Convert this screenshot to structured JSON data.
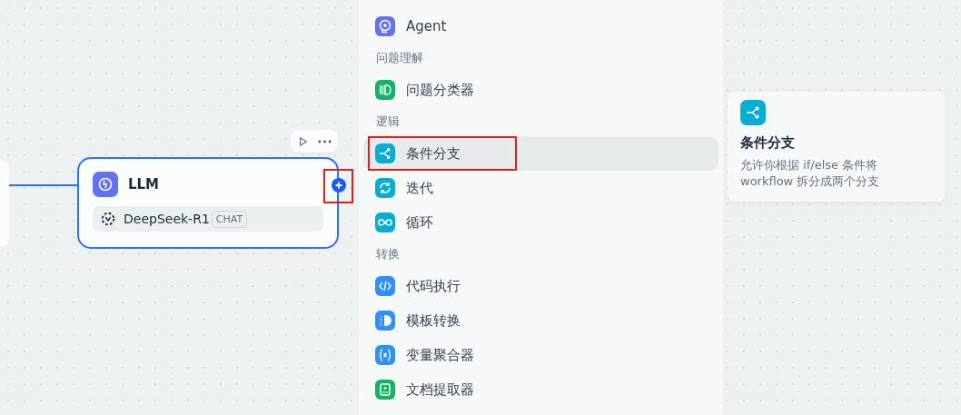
{
  "canvas": {
    "llm_node": {
      "title": "LLM",
      "selected": true,
      "model": "DeepSeek-R1",
      "badge": "CHAT",
      "add_button": {
        "highlighted": true
      }
    }
  },
  "block_menu": {
    "items": [
      {
        "kind": "item",
        "label": "Agent",
        "color": "#6172f3",
        "selected": false,
        "highlighted": false
      },
      {
        "kind": "heading",
        "label": "问题理解"
      },
      {
        "kind": "item",
        "label": "问题分类器",
        "color": "#16b364",
        "selected": false,
        "highlighted": false
      },
      {
        "kind": "heading",
        "label": "逻辑"
      },
      {
        "kind": "item",
        "label": "条件分支",
        "color": "#06aed4",
        "selected": true,
        "highlighted": true
      },
      {
        "kind": "item",
        "label": "迭代",
        "color": "#06aed4",
        "selected": false,
        "highlighted": false
      },
      {
        "kind": "item",
        "label": "循环",
        "color": "#06aed4",
        "selected": false,
        "highlighted": false
      },
      {
        "kind": "heading",
        "label": "转换"
      },
      {
        "kind": "item",
        "label": "代码执行",
        "color": "#2e90fa",
        "selected": false,
        "highlighted": false
      },
      {
        "kind": "item",
        "label": "模板转换",
        "color": "#2e90fa",
        "selected": false,
        "highlighted": false
      },
      {
        "kind": "item",
        "label": "变量聚合器",
        "color": "#2e90fa",
        "selected": false,
        "highlighted": false
      },
      {
        "kind": "item",
        "label": "文档提取器",
        "color": "#16b364",
        "selected": false,
        "highlighted": false
      }
    ]
  },
  "tooltip": {
    "title": "条件分支",
    "description": "允许你根据 if/else 条件将 workflow 拆分成两个分支",
    "color": "#06aed4"
  }
}
